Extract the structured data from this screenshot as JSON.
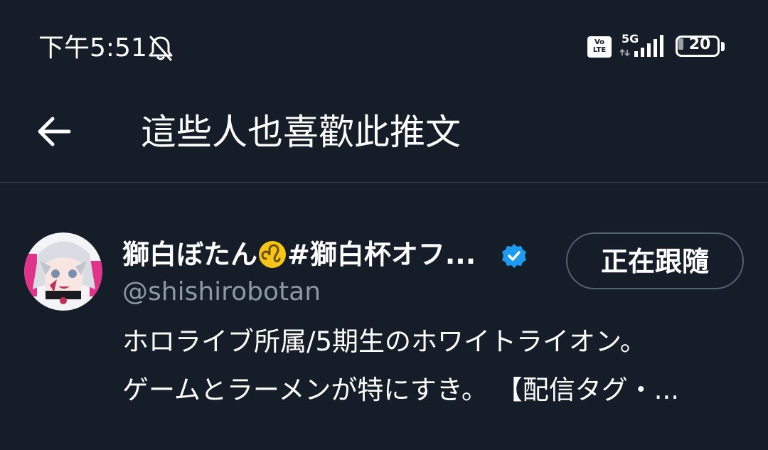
{
  "status_bar": {
    "time": "下午5:51",
    "volte_label_top": "Vo",
    "volte_label_bottom": "LTE",
    "network": "5G",
    "battery_level": "20",
    "battery_fraction": 0.2
  },
  "header": {
    "title": "這些人也喜歡此推文",
    "back_icon": "arrow-left-icon"
  },
  "user": {
    "display_name_part1": "獅白ぼたん",
    "display_name_part2": "#獅白杯オフ...",
    "leo_icon": "leo-zodiac-icon",
    "verified_icon": "verified-badge-icon",
    "handle": "@shishirobotan",
    "follow_label": "正在跟隨",
    "bio_lines": [
      "ホロライブ所属/5期生のホワイトライオン。",
      "ゲームとラーメンが特にすき。 【配信タグ・..."
    ]
  },
  "colors": {
    "background": "#151d28",
    "text_primary": "#ffffff",
    "text_secondary": "#8b98a5",
    "divider": "#38444d",
    "verified_blue": "#1d9bf0",
    "leo_yellow": "#f5c518"
  }
}
